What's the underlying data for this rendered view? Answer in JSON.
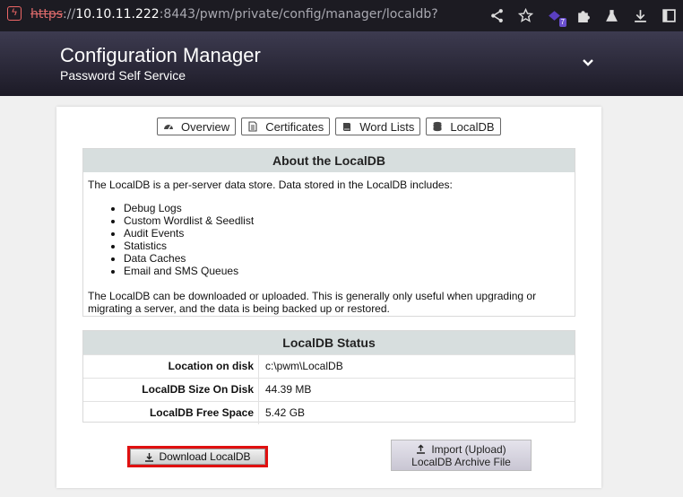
{
  "browser": {
    "url_scheme": "https",
    "url_sep": "://",
    "url_host": "10.10.11.222",
    "url_rest": ":8443/pwm/private/config/manager/localdb?",
    "extension_badge": "7",
    "icons": [
      "lightning-icon",
      "share-icon",
      "star-icon",
      "extension-icon",
      "puzzle-icon",
      "flask-icon",
      "download-icon",
      "sidebar-icon"
    ]
  },
  "header": {
    "title": "Configuration Manager",
    "subtitle": "Password Self Service"
  },
  "tabs": [
    {
      "label": "Overview",
      "icon": "dashboard-icon"
    },
    {
      "label": "Certificates",
      "icon": "document-icon"
    },
    {
      "label": "Word Lists",
      "icon": "book-icon"
    },
    {
      "label": "LocalDB",
      "icon": "database-icon"
    }
  ],
  "about": {
    "title": "About the LocalDB",
    "intro": "The LocalDB is a per-server data store. Data stored in the LocalDB includes:",
    "items": [
      "Debug Logs",
      "Custom Wordlist & Seedlist",
      "Audit Events",
      "Statistics",
      "Data Caches",
      "Email and SMS Queues"
    ],
    "outro": "The LocalDB can be downloaded or uploaded. This is generally only useful when upgrading or migrating a server, and the data is being backed up or restored."
  },
  "status": {
    "title": "LocalDB Status",
    "rows": [
      {
        "key": "Location on disk",
        "value": "c:\\pwm\\LocalDB"
      },
      {
        "key": "LocalDB Size On Disk",
        "value": "44.39 MB"
      },
      {
        "key": "LocalDB Free Space",
        "value": "5.42 GB"
      }
    ]
  },
  "actions": {
    "download_label": "Download LocalDB",
    "import_line1": "Import (Upload)",
    "import_line2": "LocalDB Archive File"
  },
  "colors": {
    "header_bg": "#2b2937",
    "box_title_bg": "#d7dede",
    "highlight": "#e01010"
  }
}
